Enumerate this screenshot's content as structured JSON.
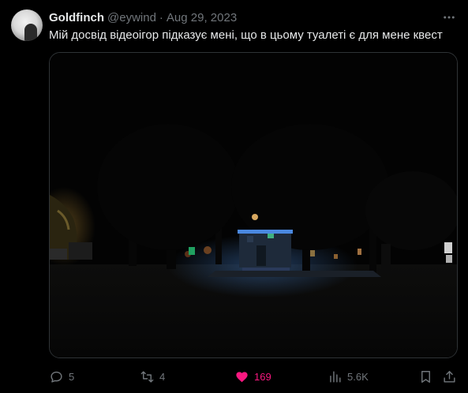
{
  "tweet": {
    "author_name": "Goldfinch",
    "handle": "@eywind",
    "separator": "·",
    "date": "Aug 29, 2023",
    "text": "Мій досвід відеоігор підказує мені, що в цьому туалеті є для мене квест"
  },
  "actions": {
    "replies": "5",
    "reposts": "4",
    "likes": "169",
    "views": "5.6K"
  },
  "colors": {
    "background": "#000000",
    "primary_text": "#e7e9ea",
    "secondary_text": "#71767b",
    "like_active": "#f91880",
    "border": "#2f3336"
  },
  "icons": [
    "more-icon",
    "reply-icon",
    "repost-icon",
    "like-icon",
    "views-icon",
    "bookmark-icon",
    "share-icon"
  ]
}
